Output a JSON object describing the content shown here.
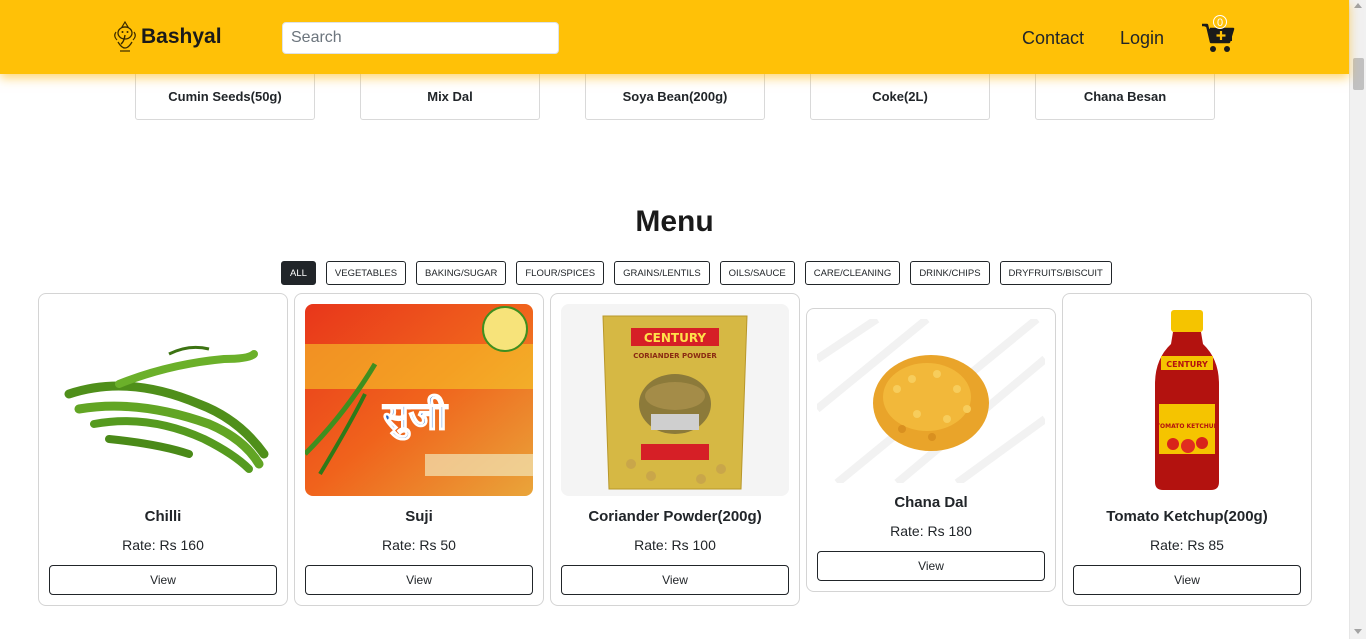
{
  "header": {
    "brand": "Bashyal",
    "search_placeholder": "Search",
    "nav": {
      "contact": "Contact",
      "login": "Login"
    },
    "cart_count": "0",
    "colors": {
      "navbar": "#ffc107"
    }
  },
  "strip": {
    "items": [
      "Cumin Seeds(50g)",
      "Mix Dal",
      "Soya Bean(200g)",
      "Coke(2L)",
      "Chana Besan"
    ]
  },
  "menu": {
    "title": "Menu",
    "filters": [
      "ALL",
      "VEGETABLES",
      "BAKING/SUGAR",
      "FLOUR/SPICES",
      "GRAINS/LENTILS",
      "OILS/SAUCE",
      "CARE/CLEANING",
      "DRINK/CHIPS",
      "DRYFRUITS/BISCUIT"
    ],
    "active_filter": "ALL"
  },
  "products": [
    {
      "name": "Chilli",
      "rate_label": "Rate: Rs",
      "price": "160",
      "view_label": "View",
      "image": "chilli-icon"
    },
    {
      "name": "Suji",
      "rate_label": "Rate: Rs",
      "price": "50",
      "view_label": "View",
      "image": "suji-package-icon",
      "package_text": "सुजी"
    },
    {
      "name": "Coriander Powder(200g)",
      "rate_label": "Rate: Rs",
      "price": "100",
      "view_label": "View",
      "image": "coriander-package-icon",
      "package_brand": "CENTURY",
      "package_label": "CORIANDER POWDER"
    },
    {
      "name": "Chana Dal",
      "rate_label": "Rate: Rs",
      "price": "180",
      "view_label": "View",
      "image": "lentils-icon"
    },
    {
      "name": "Tomato Ketchup(200g)",
      "rate_label": "Rate: Rs",
      "price": "85",
      "view_label": "View",
      "image": "ketchup-bottle-icon",
      "package_brand": "CENTURY",
      "package_label": "TOMATO KETCHUP"
    }
  ]
}
